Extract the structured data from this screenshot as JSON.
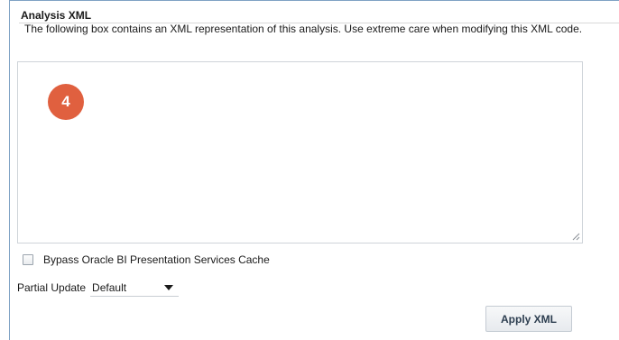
{
  "section": {
    "title": "Analysis XML",
    "description": "The following box contains an XML representation of this analysis. Use extreme care when modifying this XML code."
  },
  "xml_editor": {
    "value": ""
  },
  "step_badge": {
    "number": "4",
    "color": "#e0603f"
  },
  "cache_option": {
    "label": "Bypass Oracle BI Presentation Services Cache",
    "checked": false
  },
  "partial_update": {
    "label": "Partial Update",
    "selected": "Default"
  },
  "apply_button": {
    "label": "Apply XML"
  },
  "colors": {
    "panel_border": "#7fa2c4",
    "button_text": "#2d3e50"
  }
}
